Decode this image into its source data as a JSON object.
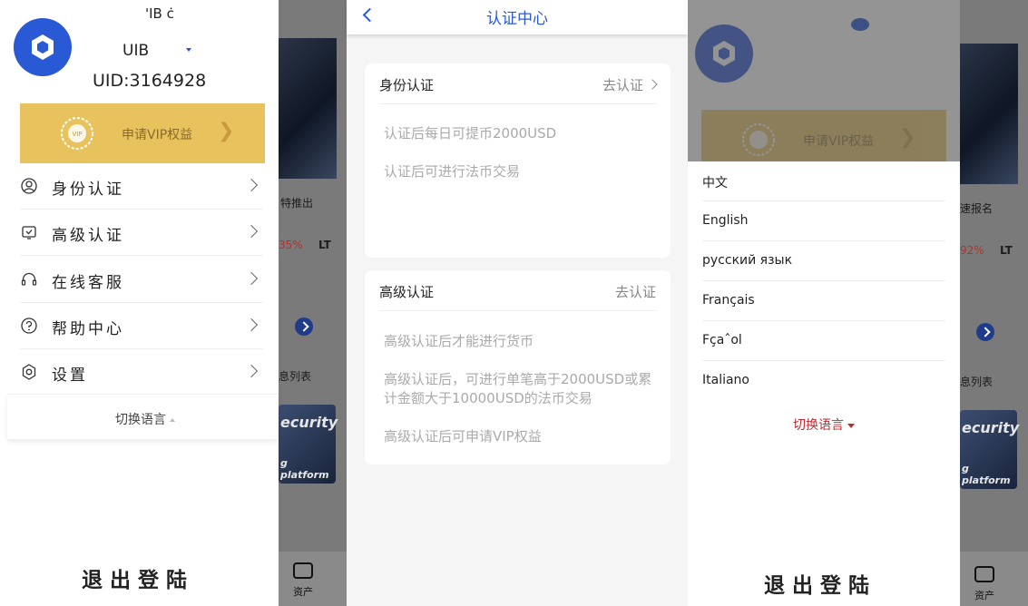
{
  "left": {
    "uid_top_partial": "'IB ċ",
    "uid_masked": "UIB",
    "uid": "UID:3164928",
    "vip_label": "申请VIP权益",
    "menu": [
      {
        "label": "身份认证",
        "icon": "user-circle-icon"
      },
      {
        "label": "高级认证",
        "icon": "shield-check-icon"
      },
      {
        "label": "在线客服",
        "icon": "headset-icon"
      },
      {
        "label": "帮助中心",
        "icon": "question-circle-icon"
      },
      {
        "label": "设置",
        "icon": "gear-icon"
      }
    ],
    "lang_switch": "切换语言",
    "logout": "退出登陆"
  },
  "background": {
    "news_1": "特推出",
    "news_2": "速报名",
    "pct_1": "35%",
    "pct_2": "92%",
    "ticker": "LT",
    "msg_list": "息列表",
    "security": "ecurity",
    "platform": "g platform",
    "asset": "资产"
  },
  "middle": {
    "title": "认证中心",
    "identity": {
      "title": "身份认证",
      "action": "去认证",
      "lines": [
        "认证后每日可提币2000USD",
        "认证后可进行法币交易"
      ]
    },
    "advanced": {
      "title": "高级认证",
      "action": "去认证",
      "lines": [
        "高级认证后才能进行货币",
        "高级认证后，可进行单笔高于2000USD或累",
        "计金额大于10000USD的法币交易",
        "高级认证后可申请VIP权益"
      ]
    }
  },
  "right": {
    "vip_label": "申请VIP权益",
    "languages": [
      "中文",
      "English",
      "русский язык",
      "Français",
      "Fçaˆol",
      "Italiano"
    ],
    "lang_switch": "切换语言",
    "logout": "退出登陆"
  },
  "colors": {
    "brand_blue": "#2a59d6",
    "vip_gold": "#e8c35d",
    "accent_red": "#c0282d"
  }
}
